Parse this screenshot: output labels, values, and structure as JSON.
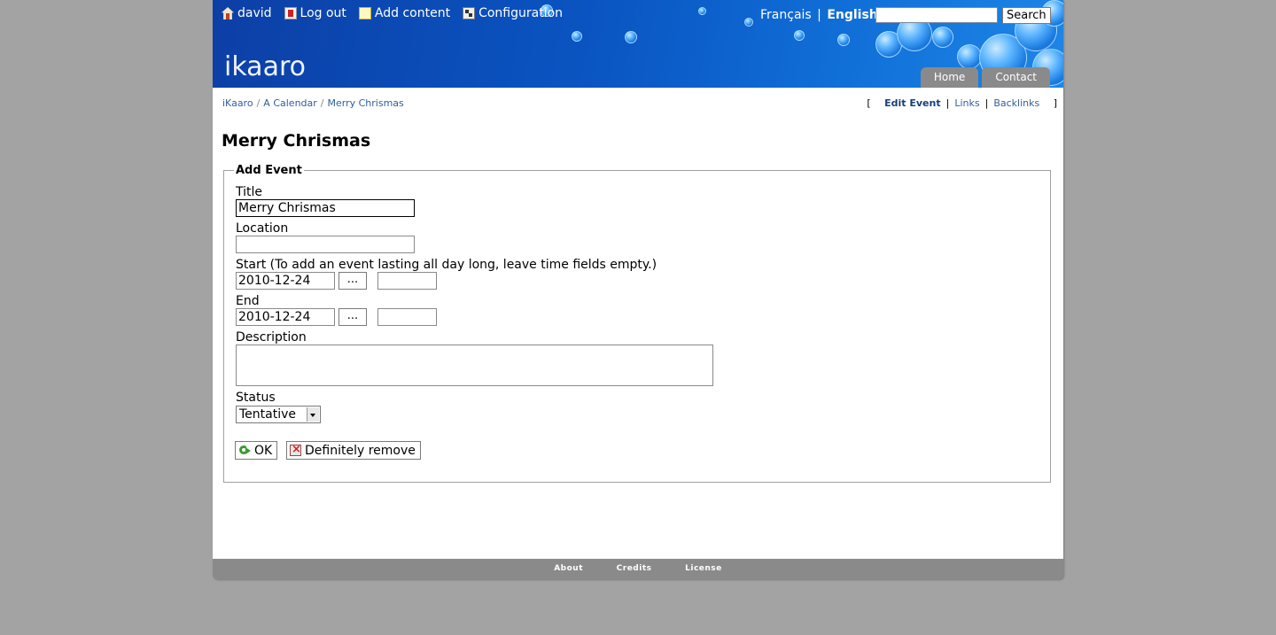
{
  "user_nav": {
    "user": "david",
    "logout": "Log out",
    "add_content": "Add content",
    "configuration": "Configuration"
  },
  "languages": {
    "francais": "Français",
    "separator": "|",
    "english": "English"
  },
  "search": {
    "value": "",
    "button": "Search"
  },
  "logo": "ikaaro",
  "tabs": [
    {
      "label": "Home"
    },
    {
      "label": "Contact"
    }
  ],
  "breadcrumb": [
    "iKaaro",
    "A Calendar",
    "Merry Chrismas"
  ],
  "actions": {
    "open": "[",
    "edit_event": "Edit Event",
    "links": "Links",
    "backlinks": "Backlinks",
    "close": "]"
  },
  "page_title": "Merry Chrismas",
  "form": {
    "legend": "Add Event",
    "title_label": "Title",
    "title_value": "Merry Chrismas",
    "location_label": "Location",
    "location_value": "",
    "start_label": "Start (To add an event lasting all day long, leave time fields empty.)",
    "start_date": "2010-12-24",
    "start_time": "",
    "end_label": "End",
    "end_date": "2010-12-24",
    "end_time": "",
    "date_picker_label": "...",
    "description_label": "Description",
    "description_value": "",
    "status_label": "Status",
    "status_value": "Tentative",
    "ok_button": "OK",
    "remove_button": "Definitely remove"
  },
  "footer": [
    "About",
    "Credits",
    "License"
  ],
  "colors": {
    "header_blue": "#0a55c2",
    "link": "#2e5f9e",
    "tab_gray": "#8a8a8a",
    "background": "#a3a3a3"
  }
}
